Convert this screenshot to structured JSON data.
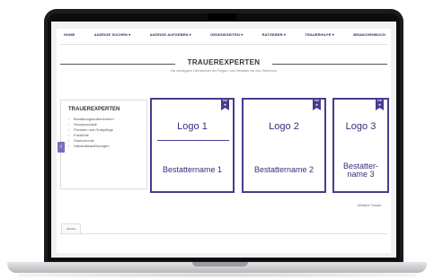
{
  "nav": {
    "items": [
      {
        "label": "HOME"
      },
      {
        "label": "ANZEIGE SUCHEN ▾"
      },
      {
        "label": "ANZEIGE AUFGEBEN ▾"
      },
      {
        "label": "GEDENKSEITEN ▾"
      },
      {
        "label": "RATGEBER ▾"
      },
      {
        "label": "TRAUERHILFE ▾"
      },
      {
        "label": "BRANCHENBUCH"
      }
    ]
  },
  "section": {
    "title": "TRAUEREXPERTEN",
    "subtitle": "Die wichtigsten Dienstleister der Region: vom Bestatter bis zum Steinmetz"
  },
  "sidebar": {
    "title": "TRAUEREXPERTEN",
    "items": [
      {
        "label": "Bestattungsunternehmen"
      },
      {
        "label": "Druckprodukte"
      },
      {
        "label": "Floristen und Grabpflege"
      },
      {
        "label": "Friedhöfe"
      },
      {
        "label": "Gastronomie"
      },
      {
        "label": "Haushaltsauflösungen"
      }
    ],
    "chevron": "›",
    "prev_arrow": "‹"
  },
  "cards": [
    {
      "badge": "TOP",
      "logo": "Logo 1",
      "name": "Bestattername 1"
    },
    {
      "badge": "TOP",
      "logo": "Logo 2",
      "name": "Bestattername 2"
    },
    {
      "badge": "TOP",
      "logo": "Logo 3",
      "name": "Bestatter-\nname 3"
    }
  ],
  "more_link": "Weitere Trauer",
  "footer_tab": "NEUEN",
  "colors": {
    "accent": "#4b3a8f",
    "nav_text": "#2e2e5c",
    "arrow": "#7a6dc0"
  }
}
